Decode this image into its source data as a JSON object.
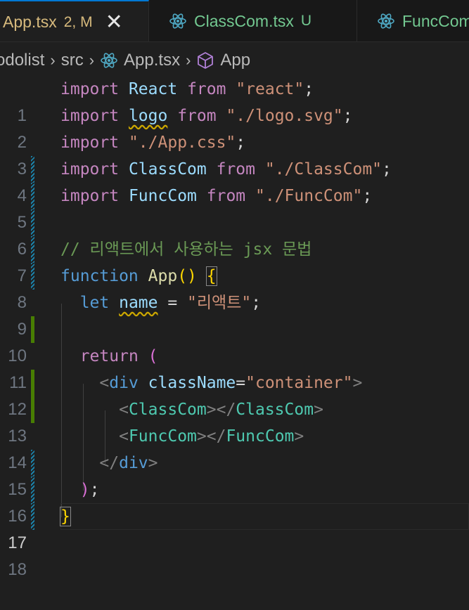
{
  "tabs": [
    {
      "name": "App.tsx",
      "badge": "2, M",
      "close": "✕",
      "color": "#d7ba7d"
    },
    {
      "name": "ClassCom.tsx",
      "badge": "U",
      "color": "#73c991"
    },
    {
      "name": "FuncCom",
      "color": "#73c991"
    }
  ],
  "breadcrumb": {
    "items": [
      "odolist",
      "src",
      "App.tsx",
      "App"
    ],
    "separator": "›"
  },
  "editor": {
    "line_numbers": [
      "1",
      "2",
      "3",
      "4",
      "5",
      "6",
      "7",
      "8",
      "9",
      "10",
      "11",
      "12",
      "13",
      "14",
      "15",
      "16",
      "17",
      "18"
    ],
    "current_line": "17",
    "tokens": {
      "import": "import",
      "from": "from",
      "react_id": "React",
      "react_str": "\"react\"",
      "logo_id": "logo",
      "logo_str": "\"./logo.svg\"",
      "css_str": "\"./App.css\"",
      "classcom_id": "ClassCom",
      "classcom_str": "\"./ClassCom\"",
      "funccom_id": "FuncCom",
      "funccom_str": "\"./FuncCom\"",
      "semicolon": ";",
      "comment": "// 리액트에서 사용하는 jsx 문법",
      "function_kw": "function",
      "app_fn": "App",
      "parens": "()",
      "open_brace": "{",
      "close_brace": "}",
      "let_kw": "let",
      "name_id": "name",
      "equals": " = ",
      "name_str": "\"리액트\"",
      "return_kw": "return",
      "open_paren": "(",
      "close_paren": ")",
      "lt": "<",
      "gt": ">",
      "lt_slash": "</",
      "div_tag": "div",
      "classname_attr": "className",
      "eq": "=",
      "container_str": "\"container\""
    }
  }
}
